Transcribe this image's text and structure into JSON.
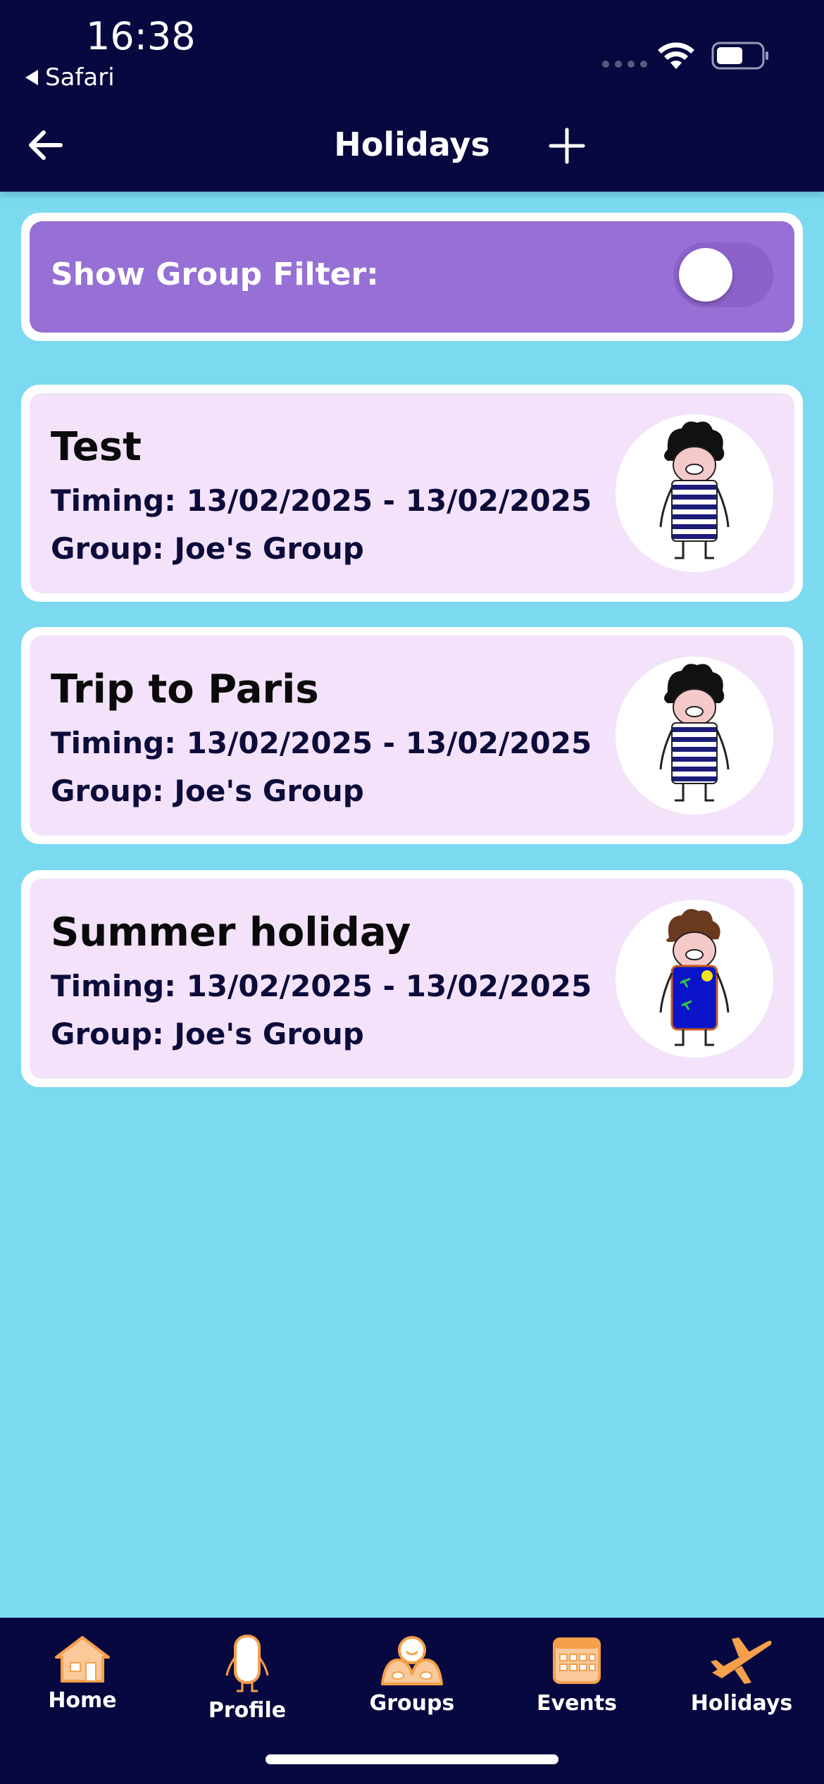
{
  "status_bar": {
    "time": "16:38",
    "back_app": "Safari",
    "icons": [
      "cellular-signal-icon",
      "wifi-icon",
      "battery-icon"
    ]
  },
  "header": {
    "title": "Holidays",
    "back_icon": "arrow-left-icon",
    "add_icon": "plus-icon"
  },
  "filter": {
    "label": "Show Group Filter:",
    "enabled": false
  },
  "holidays": [
    {
      "title": "Test",
      "timing": "Timing: 13/02/2025 - 13/02/2025",
      "group": "Group: Joe's Group",
      "avatar": "striped-shirt-character"
    },
    {
      "title": "Trip to Paris",
      "timing": "Timing: 13/02/2025 - 13/02/2025",
      "group": "Group: Joe's Group",
      "avatar": "striped-shirt-character"
    },
    {
      "title": "Summer holiday",
      "timing": "Timing: 13/02/2025 - 13/02/2025",
      "group": "Group: Joe's Group",
      "avatar": "summer-dress-character"
    }
  ],
  "tabs": [
    {
      "label": "Home",
      "icon": "house-icon"
    },
    {
      "label": "Profile",
      "icon": "person-icon"
    },
    {
      "label": "Groups",
      "icon": "group-icon"
    },
    {
      "label": "Events",
      "icon": "calendar-icon"
    },
    {
      "label": "Holidays",
      "icon": "airplane-icon"
    }
  ],
  "colors": {
    "header_bg": "#080840",
    "page_bg": "#7bdaf0",
    "filter_bg": "#9670d4",
    "card_bg": "#f3e2fa",
    "tab_icon": "#f5a04a"
  }
}
